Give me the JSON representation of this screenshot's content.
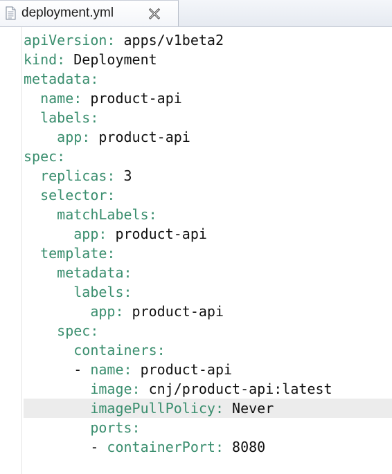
{
  "tab": {
    "title": "deployment.yml",
    "file_icon": "yaml-file-icon",
    "close_icon": "close-x-icon"
  },
  "editor": {
    "current_line_index": 19,
    "lines": [
      {
        "indent": "",
        "key": "apiVersion:",
        "value": " apps/v1beta2"
      },
      {
        "indent": "",
        "key": "kind:",
        "value": " Deployment"
      },
      {
        "indent": "",
        "key": "metadata:",
        "value": ""
      },
      {
        "indent": "  ",
        "key": "name:",
        "value": " product-api"
      },
      {
        "indent": "  ",
        "key": "labels:",
        "value": ""
      },
      {
        "indent": "    ",
        "key": "app:",
        "value": " product-api"
      },
      {
        "indent": "",
        "key": "spec:",
        "value": ""
      },
      {
        "indent": "  ",
        "key": "replicas:",
        "value": " 3"
      },
      {
        "indent": "  ",
        "key": "selector:",
        "value": ""
      },
      {
        "indent": "    ",
        "key": "matchLabels:",
        "value": ""
      },
      {
        "indent": "      ",
        "key": "app:",
        "value": " product-api"
      },
      {
        "indent": "  ",
        "key": "template:",
        "value": ""
      },
      {
        "indent": "    ",
        "key": "metadata:",
        "value": ""
      },
      {
        "indent": "      ",
        "key": "labels:",
        "value": ""
      },
      {
        "indent": "        ",
        "key": "app:",
        "value": " product-api"
      },
      {
        "indent": "    ",
        "key": "spec:",
        "value": ""
      },
      {
        "indent": "      ",
        "key": "containers:",
        "value": ""
      },
      {
        "indent": "      - ",
        "key": "name:",
        "value": " product-api"
      },
      {
        "indent": "        ",
        "key": "image:",
        "value": " cnj/product-api:latest"
      },
      {
        "indent": "        ",
        "key": "imagePullPolicy:",
        "value": " Never"
      },
      {
        "indent": "        ",
        "key": "ports:",
        "value": ""
      },
      {
        "indent": "        - ",
        "key": "containerPort:",
        "value": " 8080"
      }
    ]
  }
}
